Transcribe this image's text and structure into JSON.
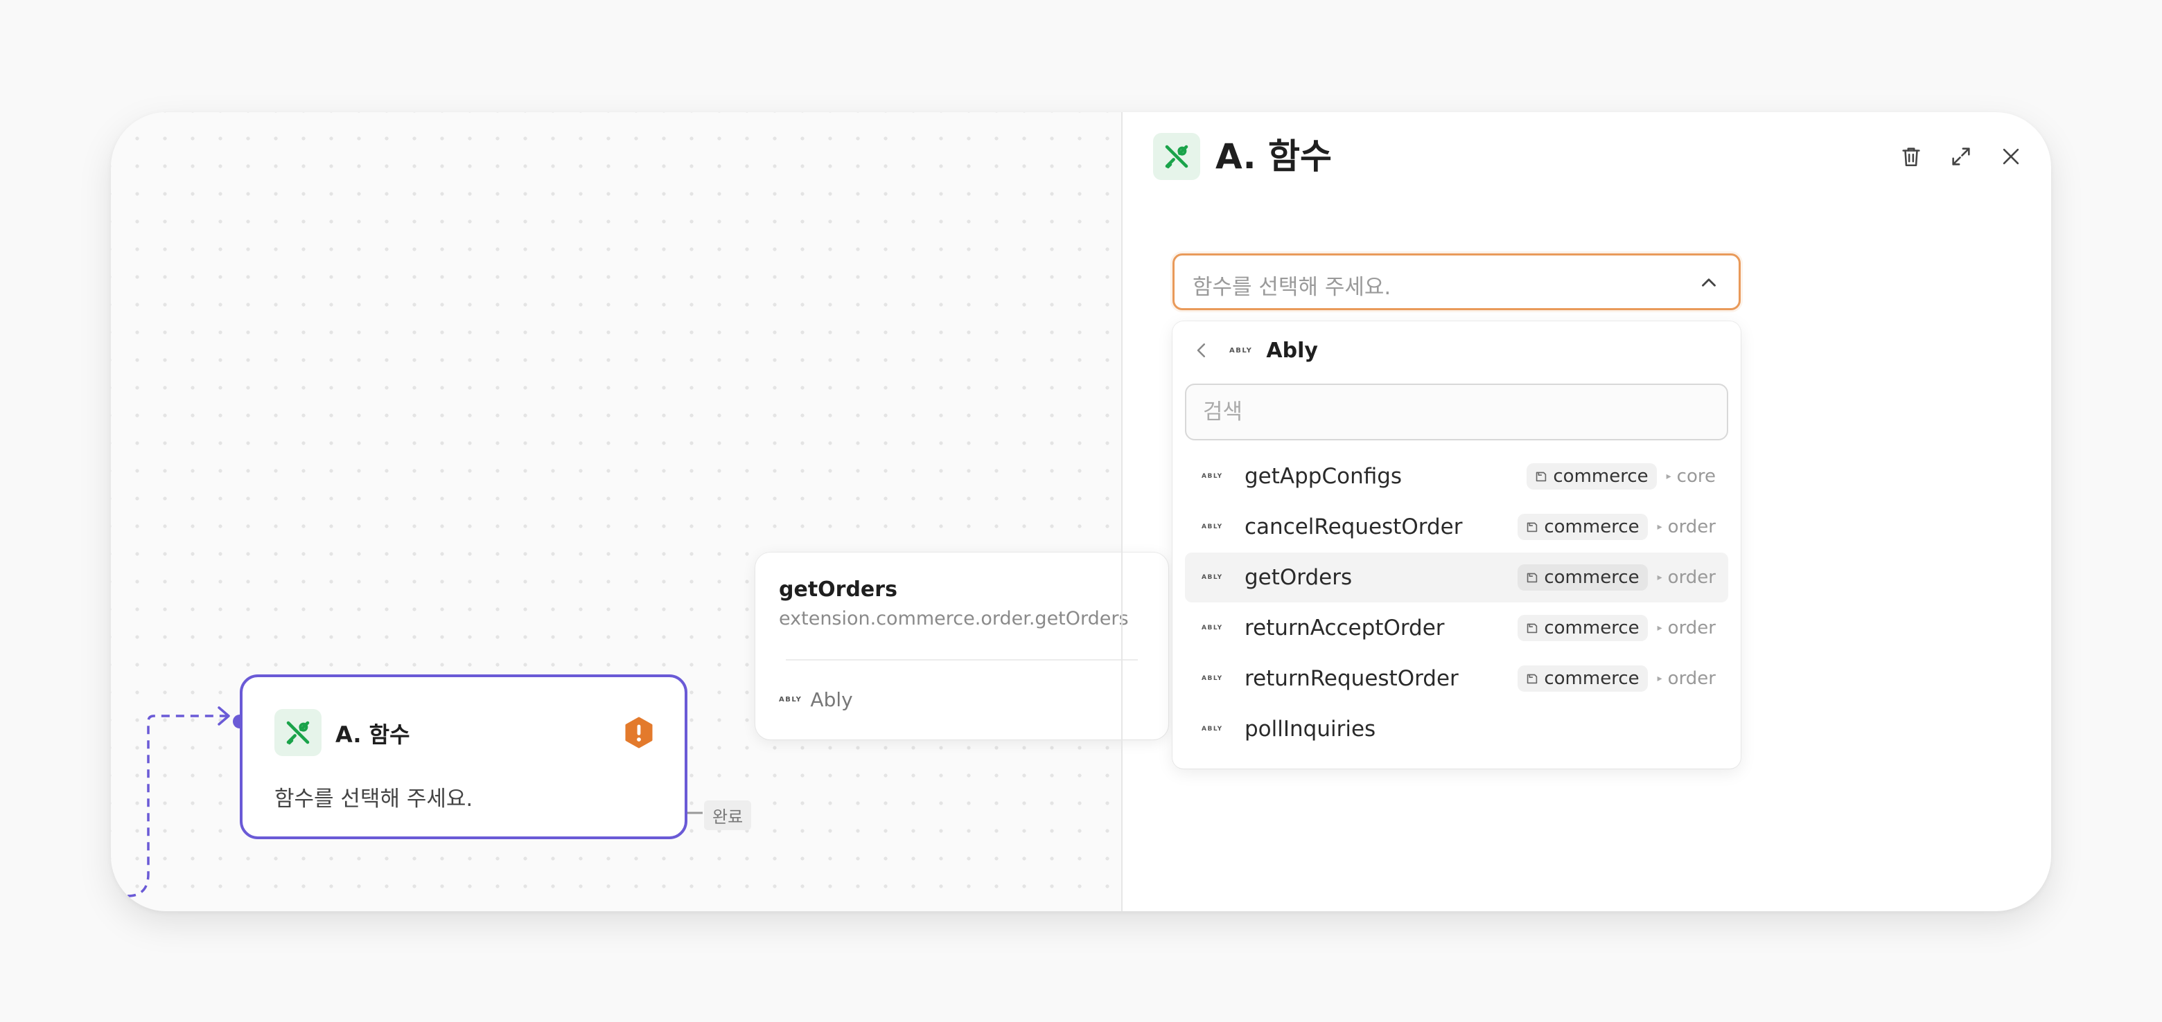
{
  "node": {
    "title": "A. 함수",
    "description": "함수를 선택해 주세요.",
    "icon": "tools-icon",
    "status_icon": "warning-icon",
    "status_color": "#e37a2c",
    "border_color": "#6a5ad6",
    "next_label": "완료"
  },
  "tooltip": {
    "title": "getOrders",
    "subtitle": "extension.commerce.order.getOrders",
    "provider": "Ably"
  },
  "panel": {
    "title": "A. 함수",
    "icon": "tools-icon",
    "actions": [
      "trash-icon",
      "expand-icon",
      "close-icon"
    ],
    "select": {
      "placeholder": "함수를 선택해 주세요.",
      "accent": "#e99a5a"
    },
    "dropdown": {
      "provider": "Ably",
      "provider_logo": "ABLY",
      "search_placeholder": "검색",
      "items": [
        {
          "name": "getAppConfigs",
          "tag": "commerce",
          "sub": "core"
        },
        {
          "name": "cancelRequestOrder",
          "tag": "commerce",
          "sub": "order"
        },
        {
          "name": "getOrders",
          "tag": "commerce",
          "sub": "order",
          "highlighted": true
        },
        {
          "name": "returnAcceptOrder",
          "tag": "commerce",
          "sub": "order"
        },
        {
          "name": "returnRequestOrder",
          "tag": "commerce",
          "sub": "order"
        },
        {
          "name": "pollInquiries",
          "tag": "",
          "sub": ""
        }
      ]
    }
  }
}
